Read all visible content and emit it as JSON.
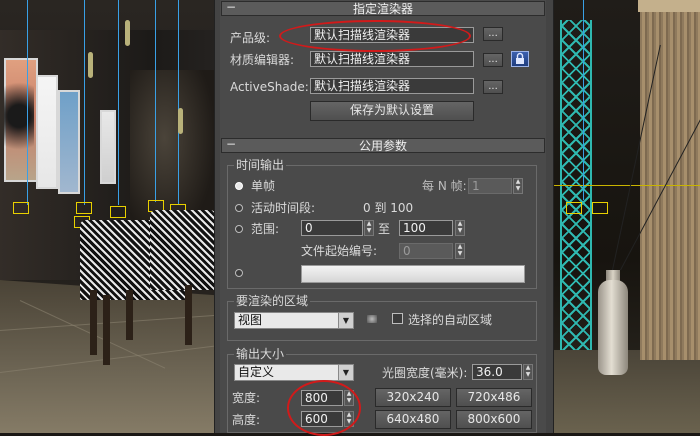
{
  "assign_renderer": {
    "title": "指定渲染器",
    "collapse_symbol": "−",
    "production_label": "产品级:",
    "production_value": "默认扫描线渲染器",
    "material_editor_label": "材质编辑器:",
    "material_editor_value": "默认扫描线渲染器",
    "activeshade_label": "ActiveShade:",
    "activeshade_value": "默认扫描线渲染器",
    "browse_label": "...",
    "save_default_label": "保存为默认设置"
  },
  "common_params": {
    "title": "公用参数",
    "collapse_symbol": "−",
    "time_output": {
      "group_title": "时间输出",
      "single_label": "单帧",
      "every_nth_label": "每 N 帧:",
      "every_nth_value": "1",
      "active_segment_label": "活动时间段:",
      "active_segment_range": "0 到 100",
      "range_label": "范围:",
      "range_from": "0",
      "range_to_label": "至",
      "range_to": "100",
      "file_start_label": "文件起始编号:",
      "file_start_value": "0",
      "selected": "single"
    },
    "area": {
      "group_title": "要渲染的区域",
      "view_value": "视图",
      "auto_region_label": "选择的自动区域",
      "auto_region_checked": false
    },
    "output_size": {
      "group_title": "输出大小",
      "preset_value": "自定义",
      "aperture_label": "光圈宽度(毫米):",
      "aperture_value": "36.0",
      "width_label": "宽度:",
      "width_value": "800",
      "height_label": "高度:",
      "height_value": "600",
      "presets": [
        "320x240",
        "720x486",
        "640x480",
        "800x600"
      ]
    }
  },
  "colors": {
    "annotation": "#d11a1a",
    "lattice": "#2fb8b0",
    "wire": "#39a0e6",
    "lamp": "#e8d000"
  }
}
